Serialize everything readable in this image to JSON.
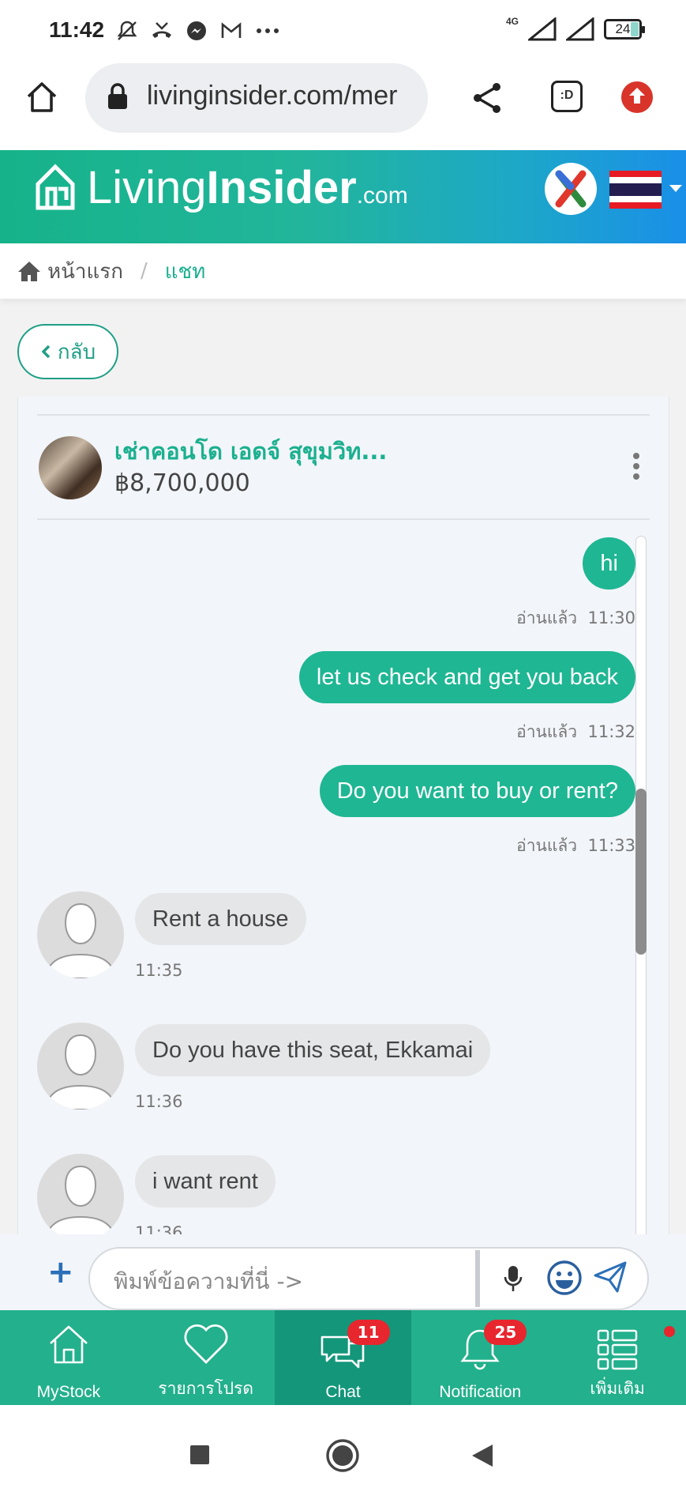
{
  "status_bar": {
    "time": "11:42",
    "network_label": "4G",
    "battery": "24",
    "icons": [
      "mute-icon",
      "missed-call-icon",
      "messenger-icon",
      "gmail-icon",
      "more-dots-icon",
      "signal-icon",
      "signal-icon",
      "battery-icon"
    ]
  },
  "browser": {
    "url": "livinginsider.com/mer",
    "tab_icon_label": ":D"
  },
  "site_header": {
    "logo_regular": "Living",
    "logo_bold": "Insider",
    "logo_suffix": ".com"
  },
  "breadcrumb": {
    "home": "หน้าแรก",
    "separator": "/",
    "current": "แชท"
  },
  "back_button": {
    "label": "กลับ"
  },
  "listing": {
    "title": "เช่าคอนโด เอดจ์ สุขุมวิท...",
    "price": "฿8,700,000"
  },
  "messages": [
    {
      "direction": "out",
      "text": "hi",
      "status": "อ่านแล้ว",
      "time": "11:30"
    },
    {
      "direction": "out",
      "text": "let us check and get you back",
      "status": "อ่านแล้ว",
      "time": "11:32"
    },
    {
      "direction": "out",
      "text": "Do you want to buy or rent?",
      "status": "อ่านแล้ว",
      "time": "11:33"
    },
    {
      "direction": "in",
      "text": "Rent a house",
      "time": "11:35"
    },
    {
      "direction": "in",
      "text": "Do you have this seat, Ekkamai",
      "time": "11:36"
    },
    {
      "direction": "in",
      "text": "i want rent",
      "time": "11:36"
    }
  ],
  "composer": {
    "placeholder": "พิมพ์ข้อความที่นี่ ->"
  },
  "bottom_nav": [
    {
      "label": "MyStock",
      "icon": "home-icon"
    },
    {
      "label": "รายการโปรด",
      "icon": "heart-icon"
    },
    {
      "label": "Chat",
      "icon": "chat-icon",
      "badge": "11",
      "active": true
    },
    {
      "label": "Notification",
      "icon": "bell-icon",
      "badge": "25"
    },
    {
      "label": "เพิ่มเติม",
      "icon": "menu-grid-icon"
    }
  ],
  "colors": {
    "brand_green": "#1fb693",
    "active_tab": "#14967a",
    "badge_red": "#e8262e",
    "link_green": "#1bb08f"
  }
}
